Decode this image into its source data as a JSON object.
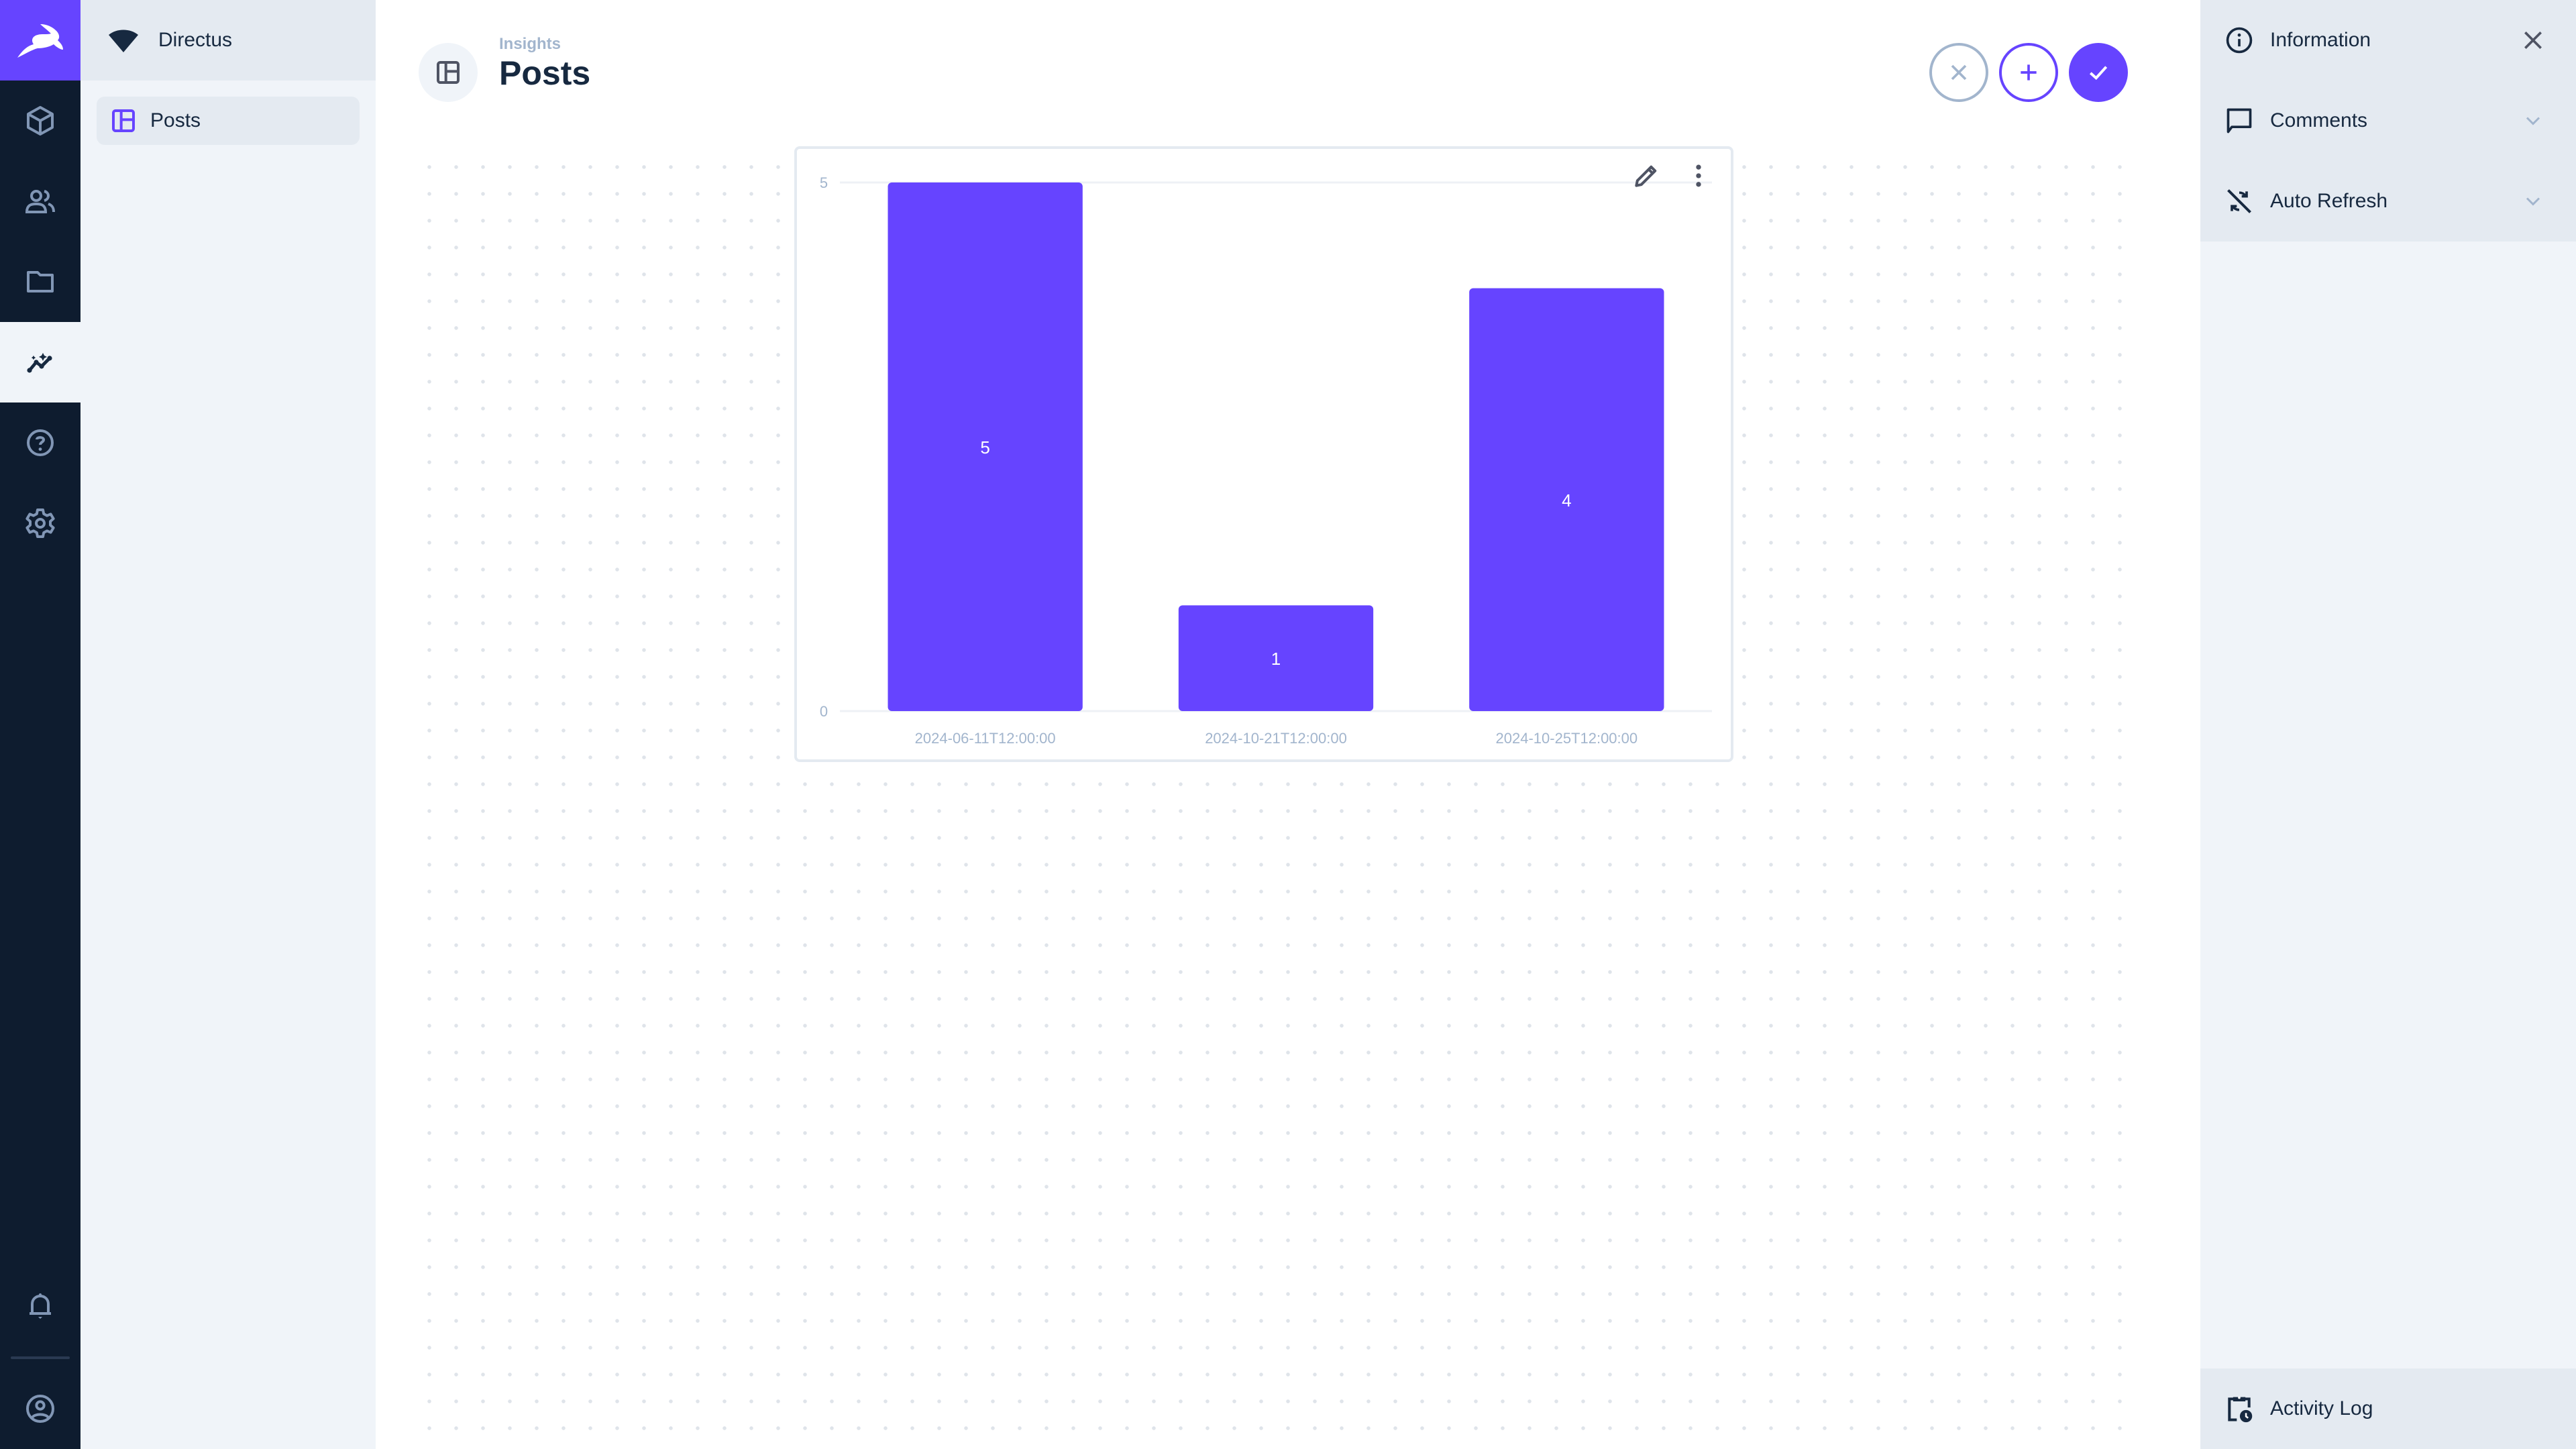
{
  "app": {
    "brand_color": "#6644ff",
    "project_name": "Directus"
  },
  "rail": {
    "modules": [
      {
        "name": "content",
        "icon": "box-icon"
      },
      {
        "name": "users",
        "icon": "users-icon"
      },
      {
        "name": "files",
        "icon": "folder-icon"
      },
      {
        "name": "insights",
        "icon": "insights-icon",
        "active": true
      },
      {
        "name": "help",
        "icon": "help-icon"
      },
      {
        "name": "settings",
        "icon": "gear-icon"
      }
    ],
    "bottom": [
      {
        "name": "notifications",
        "icon": "bell-icon"
      },
      {
        "name": "user",
        "icon": "account-icon"
      }
    ]
  },
  "nav": {
    "items": [
      {
        "label": "Posts",
        "icon": "dashboard-icon",
        "active": true
      }
    ]
  },
  "header": {
    "breadcrumb": "Insights",
    "title": "Posts",
    "actions": [
      {
        "name": "cancel",
        "icon": "close-icon"
      },
      {
        "name": "add",
        "icon": "plus-icon"
      },
      {
        "name": "save",
        "icon": "check-icon"
      }
    ]
  },
  "sidebar": {
    "sections": [
      {
        "label": "Information",
        "icon": "info-icon",
        "right_icon": "close-icon"
      },
      {
        "label": "Comments",
        "icon": "comment-icon",
        "right_icon": "chevron-down-icon"
      },
      {
        "label": "Auto Refresh",
        "icon": "sync-disabled-icon",
        "right_icon": "chevron-down-icon"
      }
    ],
    "activity_log": "Activity Log"
  },
  "chart_data": {
    "type": "bar",
    "title": "",
    "categories": [
      "2024-06-11T12:00:00",
      "2024-10-21T12:00:00",
      "2024-10-25T12:00:00"
    ],
    "values": [
      5,
      1,
      4
    ],
    "data_labels": [
      "5",
      "1",
      "4"
    ],
    "y_ticks": [
      "0",
      "5"
    ],
    "ylim": [
      0,
      5
    ],
    "xlabel": "",
    "ylabel": "",
    "grid": true,
    "color": "#6644ff"
  }
}
